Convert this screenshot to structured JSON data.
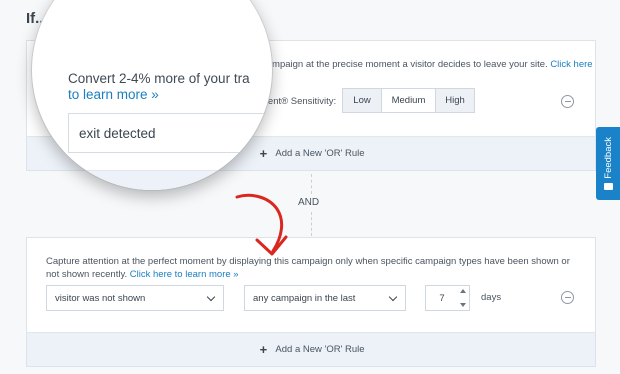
{
  "heading": "If...",
  "rule1": {
    "description_prefix": "campaign at the precise moment a visitor decides to leave your site.",
    "learn_more_link": "Click here",
    "sensitivity_label": "ntent® Sensitivity:",
    "sensitivity_options": [
      "Low",
      "Medium",
      "High"
    ],
    "sensitivity_selected": "Medium",
    "add_or_rule": "Add a New 'OR' Rule"
  },
  "connector": {
    "label": "AND"
  },
  "rule2": {
    "description": "Capture attention at the perfect moment by displaying this campaign only when specific campaign types have been shown or not shown recently.",
    "learn_more_link": "Click here to learn more »",
    "visitor_condition": "visitor was not shown",
    "campaign_condition": "any campaign in the last",
    "days_value": "7",
    "days_unit": "days",
    "add_or_rule": "Add a New 'OR' Rule"
  },
  "feedback": {
    "label": "Feedback"
  },
  "magnifier": {
    "line1": "Convert 2-4% more of your tra",
    "line2_link": "to learn more »",
    "input_value": "exit detected"
  },
  "colors": {
    "accent": "#1a7fc1",
    "feedback_bg": "#1a82c8",
    "arrow": "#d9281f",
    "panel_footer": "#edf2f8"
  },
  "icons": [
    "plus-icon",
    "minus-circle-icon",
    "chevron-down-icon",
    "stepper-arrows-icon",
    "feedback-icon",
    "arrow-annotation-icon"
  ]
}
